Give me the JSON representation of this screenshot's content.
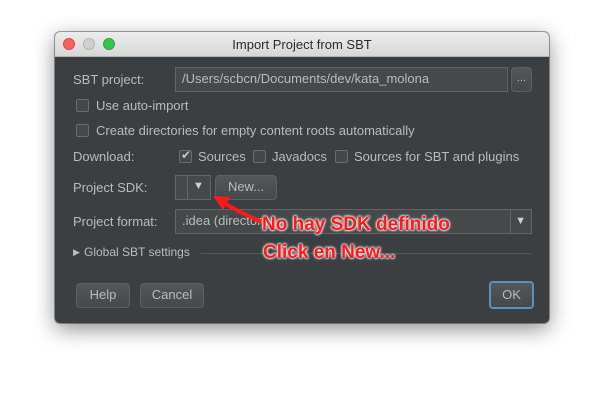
{
  "window": {
    "title": "Import Project from SBT"
  },
  "sbt_project": {
    "label": "SBT project:",
    "path": "/Users/scbcn/Documents/dev/kata_molona",
    "browse_label": "..."
  },
  "options": {
    "auto_import": {
      "label": "Use auto-import",
      "checked": false
    },
    "create_dirs": {
      "label": "Create directories for empty content roots automatically",
      "checked": false
    }
  },
  "download": {
    "label": "Download:",
    "sources": {
      "label": "Sources",
      "checked": true
    },
    "javadocs": {
      "label": "Javadocs",
      "checked": false
    },
    "sbt_sources": {
      "label": "Sources for SBT and plugins",
      "checked": false
    }
  },
  "project_sdk": {
    "label": "Project SDK:",
    "value": "",
    "new_label": "New..."
  },
  "project_format": {
    "label": "Project format:",
    "value": ".idea (director"
  },
  "global_settings": {
    "label": "Global SBT settings"
  },
  "buttons": {
    "help": "Help",
    "cancel": "Cancel",
    "ok": "OK"
  },
  "annotation": {
    "line1": "No hay SDK definido",
    "line2": "Click en New...",
    "color": "#ff1a1a"
  },
  "icons": {
    "dropdown": "triangle-down",
    "disclosure": "triangle-right",
    "check": "check-mark"
  },
  "colors": {
    "dialog_bg": "#3c3f41",
    "ok_border": "#5d8fc4"
  }
}
